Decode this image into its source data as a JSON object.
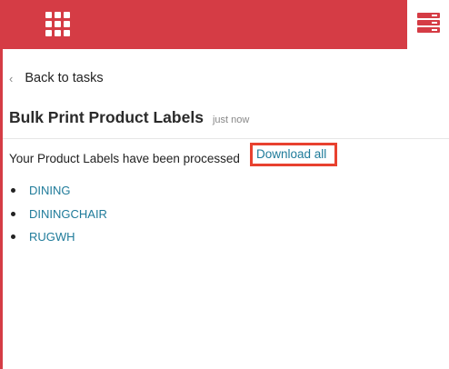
{
  "header": {
    "apps_icon": "grid-icon",
    "tasks_icon": "stacked-tasks-icon",
    "brand_color": "#d53c45"
  },
  "nav": {
    "back_icon": "chevron-left-icon",
    "back_label": "Back to tasks"
  },
  "task": {
    "title": "Bulk Print Product Labels",
    "timestamp": "just now",
    "message": "Your Product Labels have been processed",
    "download_label": "Download all",
    "highlight_color": "#e8412f",
    "link_color": "#1f7b9a",
    "files": [
      {
        "label": "DINING"
      },
      {
        "label": "DININGCHAIR"
      },
      {
        "label": "RUGWH"
      }
    ]
  }
}
